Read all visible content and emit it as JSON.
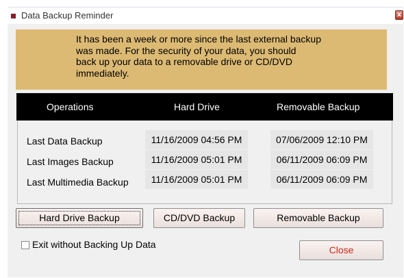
{
  "window": {
    "title": "Data Backup Reminder",
    "close_glyph": "x"
  },
  "message": {
    "text": "It has been a week or more since the last external backup\nwas made.  For the security of your data, you should\nback up your data to a removable drive or CD/DVD\nimmediately."
  },
  "table": {
    "headers": {
      "operations": "Operations",
      "hard_drive": "Hard Drive",
      "removable": "Removable Backup"
    },
    "rows": [
      {
        "label": "Last Data Backup",
        "hard_drive": "11/16/2009 04:56 PM",
        "removable": "07/06/2009 12:10 PM"
      },
      {
        "label": "Last Images Backup",
        "hard_drive": "11/16/2009 05:01 PM",
        "removable": "06/11/2009 06:09 PM"
      },
      {
        "label": "Last Multimedia Backup",
        "hard_drive": "11/16/2009 05:01 PM",
        "removable": "06/11/2009 06:09 PM"
      }
    ]
  },
  "buttons": {
    "hard_drive_backup": "Hard Drive Backup",
    "cd_dvd_backup": "CD/DVD Backup",
    "removable_backup": "Removable Backup",
    "close": "Close"
  },
  "checkbox": {
    "label": "Exit without Backing Up Data",
    "checked": false
  },
  "colors": {
    "message_bg": "#dcba74",
    "header_bg": "#000000",
    "close_text": "#cc2a1a",
    "title_icon": "#8c1c2b"
  }
}
